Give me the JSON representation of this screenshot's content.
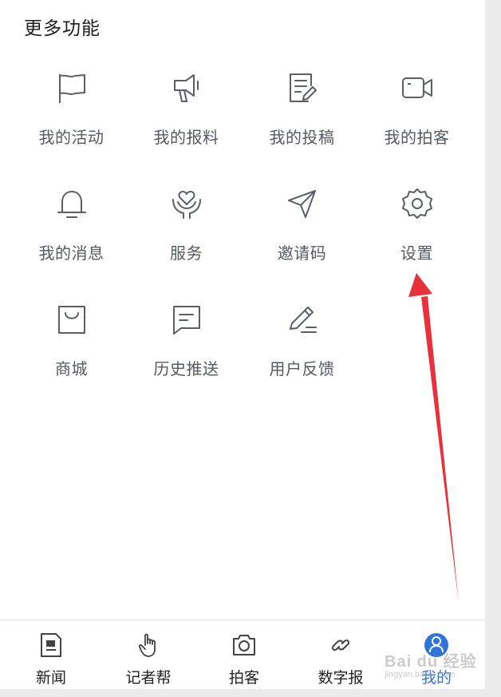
{
  "section": {
    "title": "更多功能"
  },
  "features": [
    {
      "label": "我的活动",
      "icon": "flag-icon"
    },
    {
      "label": "我的报料",
      "icon": "megaphone-icon"
    },
    {
      "label": "我的投稿",
      "icon": "document-edit-icon"
    },
    {
      "label": "我的拍客",
      "icon": "video-camera-icon"
    },
    {
      "label": "我的消息",
      "icon": "bell-icon"
    },
    {
      "label": "服务",
      "icon": "heart-hands-icon"
    },
    {
      "label": "邀请码",
      "icon": "paper-plane-icon"
    },
    {
      "label": "设置",
      "icon": "gear-icon"
    },
    {
      "label": "商城",
      "icon": "shopping-bag-icon"
    },
    {
      "label": "历史推送",
      "icon": "message-icon"
    },
    {
      "label": "用户反馈",
      "icon": "pencil-icon"
    }
  ],
  "tabbar": {
    "tabs": [
      {
        "label": "新闻",
        "icon": "news-icon"
      },
      {
        "label": "记者帮",
        "icon": "hand-tap-icon"
      },
      {
        "label": "拍客",
        "icon": "camera-icon"
      },
      {
        "label": "数字报",
        "icon": "link-icon"
      },
      {
        "label": "我的",
        "icon": "user-icon",
        "active": true
      }
    ]
  },
  "watermark": {
    "text": "Bai du 经验",
    "sub": "jingyan.baidu.com"
  },
  "colors": {
    "icon": "#5a5f66",
    "active": "#2f74d6",
    "arrow": "#e8313a"
  }
}
